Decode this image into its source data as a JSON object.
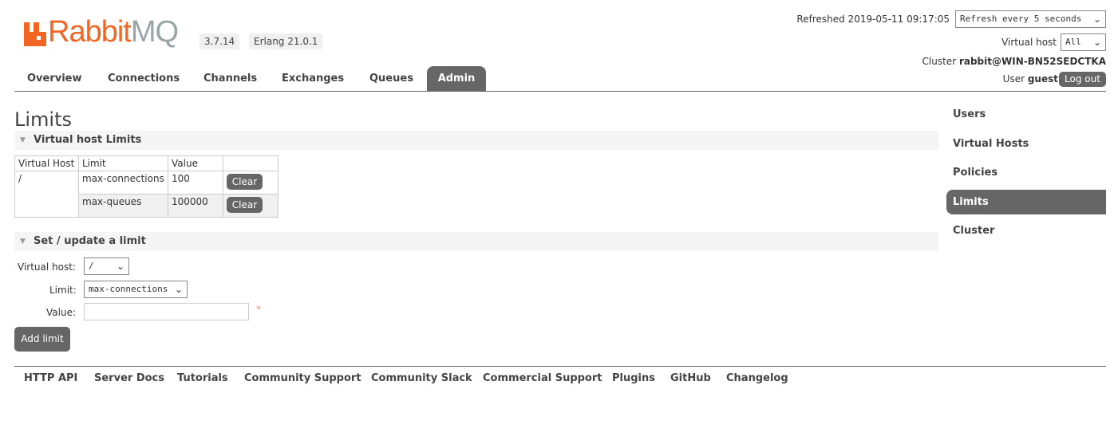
{
  "header": {
    "logo_text": "RabbitMQ",
    "version": "3.7.14",
    "erlang": "Erlang 21.0.1",
    "refreshed": "Refreshed 2019-05-11 09:17:05",
    "refresh_select": "Refresh every 5 seconds",
    "vhost_label": "Virtual host",
    "vhost_select": "All",
    "cluster_label": "Cluster",
    "cluster_name": "rabbit@WIN-BN52SEDCTKA",
    "user_label": "User",
    "user_name": "guest",
    "logout": "Log out"
  },
  "nav": [
    "Overview",
    "Connections",
    "Channels",
    "Exchanges",
    "Queues",
    "Admin"
  ],
  "page_title": "Limits",
  "vhost_limits": {
    "title": "Virtual host Limits",
    "columns": [
      "Virtual Host",
      "Limit",
      "Value",
      ""
    ],
    "vhost": "/",
    "rows": [
      {
        "limit": "max-connections",
        "value": "100",
        "action": "Clear"
      },
      {
        "limit": "max-queues",
        "value": "100000",
        "action": "Clear"
      }
    ]
  },
  "form": {
    "title": "Set / update a limit",
    "vhost_label": "Virtual host:",
    "vhost_value": "/",
    "limit_label": "Limit:",
    "limit_value": "max-connections",
    "value_label": "Value:",
    "value_value": "",
    "required": "*",
    "submit": "Add limit"
  },
  "sidebar": [
    "Users",
    "Virtual Hosts",
    "Policies",
    "Limits",
    "Cluster"
  ],
  "footer": [
    "HTTP API",
    "Server Docs",
    "Tutorials",
    "Community Support",
    "Community Slack",
    "Commercial Support",
    "Plugins",
    "GitHub",
    "Changelog"
  ],
  "colors": {
    "brand": "#f26522",
    "active": "#666666"
  }
}
